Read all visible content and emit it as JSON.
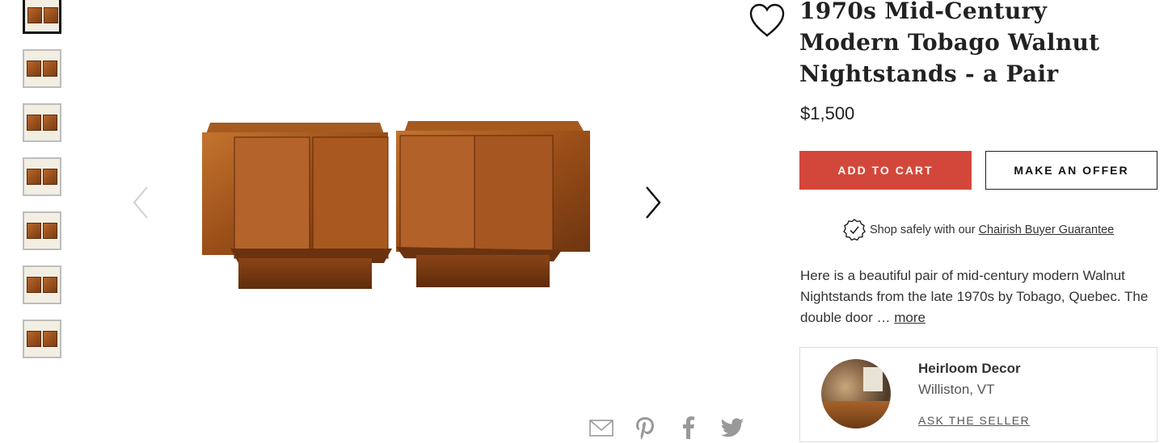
{
  "product": {
    "title": "1970s Mid-Century Modern Tobago Walnut Nightstands - a Pair",
    "price": "$1,500",
    "description": "Here is a beautiful pair of mid-century modern Walnut Nightstands from the late 1970s by Tobago, Quebec. The double door … ",
    "more_label": "more"
  },
  "actions": {
    "add_to_cart": "ADD TO CART",
    "make_offer": "MAKE AN OFFER"
  },
  "guarantee": {
    "text": "Shop safely with our",
    "link": "Chairish Buyer Guarantee"
  },
  "seller": {
    "name": "Heirloom Decor",
    "location": "Williston, VT",
    "ask_label": "ASK THE SELLER"
  },
  "gallery": {
    "thumbnail_count": 7,
    "active_index": 0
  },
  "share_icons": [
    "email-icon",
    "pinterest-icon",
    "facebook-icon",
    "twitter-icon"
  ],
  "colors": {
    "cart_button": "#d3473b",
    "text": "#222222"
  }
}
